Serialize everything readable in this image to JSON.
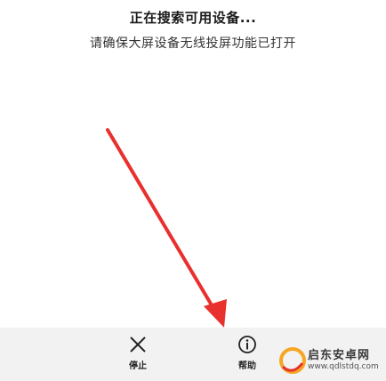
{
  "status": {
    "title": "正在搜索可用设备...",
    "subtitle": "请确保大屏设备无线投屏功能已打开"
  },
  "bottom_bar": {
    "stop_label": "停止",
    "help_label": "帮助"
  },
  "watermark": {
    "text": "启东安卓网",
    "url": "www.qdlstdq.com"
  },
  "colors": {
    "arrow": "#e8302e",
    "bar_background": "#f2f2f2",
    "watermark_accent": "#f5a623"
  }
}
